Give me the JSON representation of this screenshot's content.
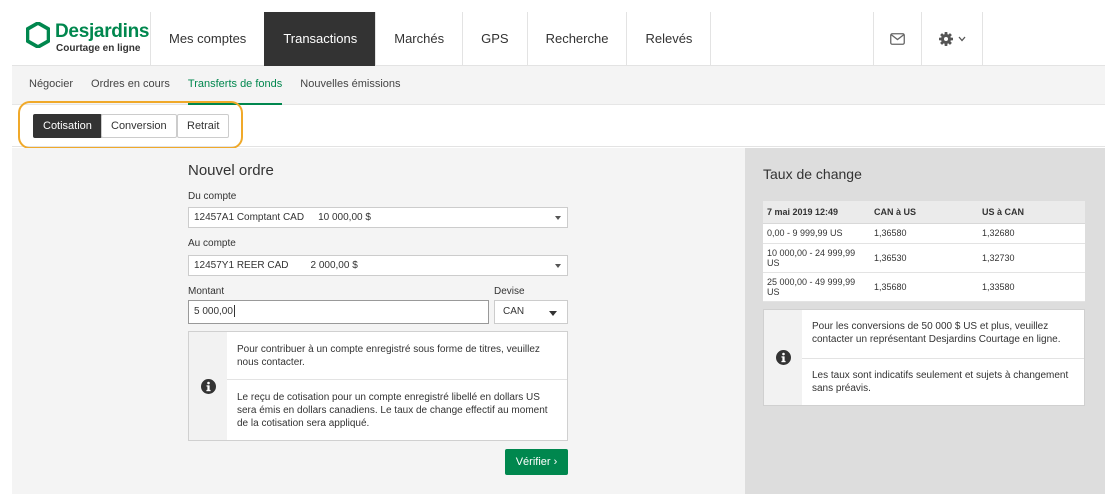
{
  "brand": {
    "name": "Desjardins",
    "subtitle": "Courtage en ligne",
    "color": "#00874e"
  },
  "nav": {
    "items": [
      {
        "label": "Mes comptes"
      },
      {
        "label": "Transactions"
      },
      {
        "label": "Marchés"
      },
      {
        "label": "GPS"
      },
      {
        "label": "Recherche"
      },
      {
        "label": "Relevés"
      }
    ],
    "active": "Transactions"
  },
  "header_icons": [
    "mail-icon",
    "gear-icon",
    "chevron-down-icon"
  ],
  "subnav": {
    "items": [
      {
        "label": "Négocier"
      },
      {
        "label": "Ordres en cours"
      },
      {
        "label": "Transferts de fonds"
      },
      {
        "label": "Nouvelles émissions"
      }
    ],
    "active": "Transferts de fonds"
  },
  "tabs": {
    "items": [
      {
        "label": "Cotisation"
      },
      {
        "label": "Conversion"
      },
      {
        "label": "Retrait"
      }
    ],
    "active": "Cotisation",
    "highlight_color": "#f0a92a"
  },
  "form": {
    "title": "Nouvel ordre",
    "from_account": {
      "label": "Du compte",
      "account": "12457A1 Comptant CAD",
      "balance": "10 000,00 $"
    },
    "to_account": {
      "label": "Au compte",
      "account": "12457Y1 REER CAD",
      "balance": "2 000,00 $"
    },
    "amount": {
      "label": "Montant",
      "value": "5 000,00"
    },
    "currency": {
      "label": "Devise",
      "value": "CAN"
    },
    "info": {
      "icon": "info-icon",
      "message1": "Pour contribuer à un compte enregistré sous forme de titres, veuillez nous contacter.",
      "message2": "Le reçu de cotisation pour un compte enregistré libellé en dollars US sera émis en dollars canadiens. Le taux de change effectif au moment de la cotisation sera appliqué."
    },
    "submit_label": "Vérifier ›"
  },
  "rates": {
    "title": "Taux de change",
    "columns": [
      "7 mai 2019 12:49",
      "CAN à US",
      "US à CAN"
    ],
    "rows": [
      {
        "range": "0,00 - 9 999,99 US",
        "can_us": "1,36580",
        "us_can": "1,32680"
      },
      {
        "range": "10 000,00 - 24 999,99 US",
        "can_us": "1,36530",
        "us_can": "1,32730"
      },
      {
        "range": "25 000,00 - 49 999,99 US",
        "can_us": "1,35680",
        "us_can": "1,33580"
      }
    ],
    "info": {
      "icon": "info-icon",
      "message1": "Pour les conversions de 50 000 $ US et plus, veuillez contacter un représentant Desjardins Courtage en ligne.",
      "message2": "Les taux sont indicatifs seulement et sujets à changement sans préavis."
    }
  }
}
